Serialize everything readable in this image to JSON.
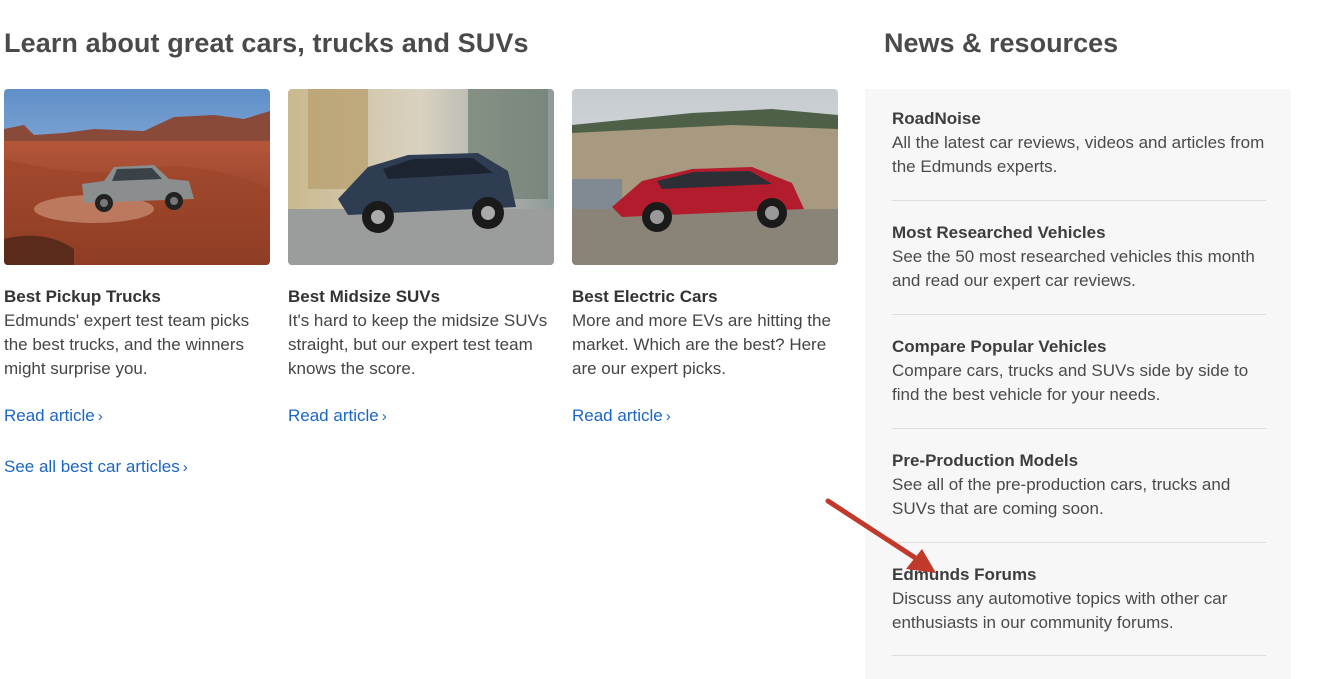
{
  "left_heading": "Learn about great cars, trucks and SUVs",
  "right_heading": "News & resources",
  "cards": [
    {
      "title": "Best Pickup Trucks",
      "description": "Edmunds' expert test team picks the best trucks, and the winners might surprise you.",
      "link_label": "Read article"
    },
    {
      "title": "Best Midsize SUVs",
      "description": "It's hard to keep the midsize SUVs straight, but our expert test team knows the score.",
      "link_label": "Read article"
    },
    {
      "title": "Best Electric Cars",
      "description": "More and more EVs are hitting the market. Which are the best? Here are our expert picks.",
      "link_label": "Read article"
    }
  ],
  "see_all_label": "See all best car articles",
  "news": [
    {
      "title": "RoadNoise",
      "description": "All the latest car reviews, videos and articles from the Edmunds experts."
    },
    {
      "title": "Most Researched Vehicles",
      "description": "See the 50 most researched vehicles this month and read our expert car reviews."
    },
    {
      "title": "Compare Popular Vehicles",
      "description": "Compare cars, trucks and SUVs side by side to find the best vehicle for your needs."
    },
    {
      "title": "Pre-Production Models",
      "description": "See all of the pre-production cars, trucks and SUVs that are coming soon."
    },
    {
      "title": "Edmunds Forums",
      "description": "Discuss any automotive topics with other car enthusiasts in our community forums."
    }
  ],
  "colors": {
    "link": "#1a66c4",
    "arrow": "#c0392b",
    "panel": "#f7f7f7"
  }
}
